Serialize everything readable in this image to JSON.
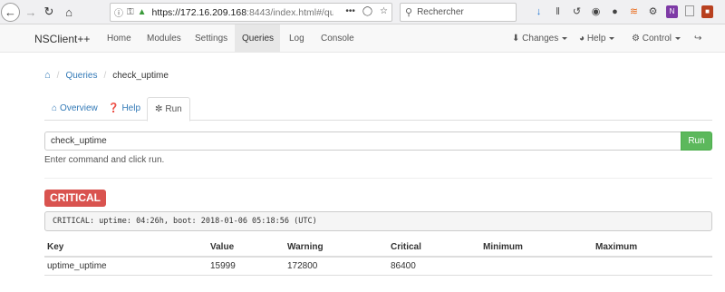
{
  "browser": {
    "url_host": "https://172.16.209.168",
    "url_rest": ":8443/index.html#/que",
    "search_placeholder": "Rechercher",
    "url_more": "•••"
  },
  "navbar": {
    "brand": "NSClient++",
    "items": [
      {
        "label": "Home"
      },
      {
        "label": "Modules"
      },
      {
        "label": "Settings"
      },
      {
        "label": "Queries"
      },
      {
        "label": "Log"
      },
      {
        "label": "Console"
      }
    ],
    "active": "Queries",
    "changes_label": "Changes",
    "help_label": "Help",
    "control_label": "Control"
  },
  "breadcrumb": {
    "queries": "Queries",
    "current": "check_uptime"
  },
  "tabs": [
    {
      "label": "Overview",
      "icon": "home-icon"
    },
    {
      "label": "Help",
      "icon": "question-circle-icon"
    },
    {
      "label": "Run",
      "icon": "fire-icon"
    }
  ],
  "command": {
    "value": "check_uptime",
    "run_label": "Run",
    "help_text": "Enter command and click run."
  },
  "result": {
    "status": "CRITICAL",
    "status_color": "#d9534f",
    "output": "CRITICAL: uptime: 04:26h, boot: 2018-01-06 05:18:56 (UTC)",
    "table": {
      "headers": [
        "Key",
        "Value",
        "Warning",
        "Critical",
        "Minimum",
        "Maximum"
      ],
      "rows": [
        [
          "uptime_uptime",
          "15999",
          "172800",
          "86400",
          "",
          ""
        ]
      ]
    }
  }
}
